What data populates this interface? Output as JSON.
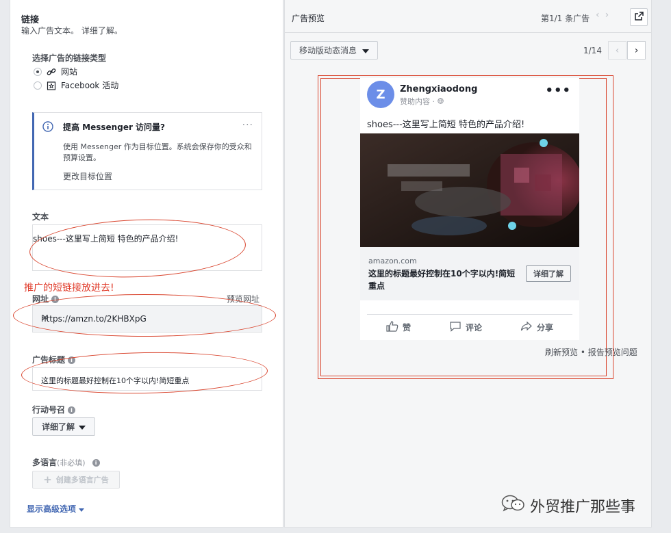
{
  "left": {
    "section_title": "链接",
    "section_subtitle": "输入广告文本。",
    "learn_more": "详细了解。",
    "link_type_label": "选择广告的链接类型",
    "link_types": [
      {
        "label": "网站",
        "selected": true,
        "icon": "link-icon"
      },
      {
        "label": "Facebook 活动",
        "selected": false,
        "icon": "event-icon"
      }
    ],
    "info_box": {
      "title": "提高 Messenger 访问量?",
      "body": "使用 Messenger 作为目标位置。系统会保存你的受众和预算设置。",
      "link": "更改目标位置",
      "more": "···"
    },
    "text_label": "文本",
    "text_value": "shoes---这里写上简短 特色的产品介绍!",
    "annotation": "推广的短链接放进去!",
    "url_label": "网址",
    "url_preview": "预览网址",
    "url_value": "https://amzn.to/2KHBXpG",
    "url_clear": "✕",
    "headline_label": "广告标题",
    "headline_value": "这里的标题最好控制在10个字以内!简短重点",
    "cta_label": "行动号召",
    "cta_value": "详细了解",
    "multilang_label": "多语言",
    "multilang_optional": "(非必填)",
    "multilang_button": "创建多语言广告",
    "advanced": "显示高级选项"
  },
  "right": {
    "title": "广告预览",
    "ad_count": "第1/1 条广告",
    "placement": "移动版动态消息",
    "page_indicator": "1/14",
    "ad": {
      "avatar_letter": "Z",
      "page_name": "Zhengxiaodong",
      "sponsored": "赞助内容 · ",
      "more": "•••",
      "text": "shoes---这里写上简短 特色的产品介绍!",
      "domain": "amazon.com",
      "headline": "这里的标题最好控制在10个字以内!简短重点",
      "cta": "详细了解",
      "like": "赞",
      "comment": "评论",
      "share": "分享"
    },
    "footer": "刷新预览 • 报告预览问题"
  },
  "watermark": "外贸推广那些事",
  "colors": {
    "accent": "#4267b2",
    "annotation": "#d9442d",
    "avatar": "#6c8ee8"
  }
}
